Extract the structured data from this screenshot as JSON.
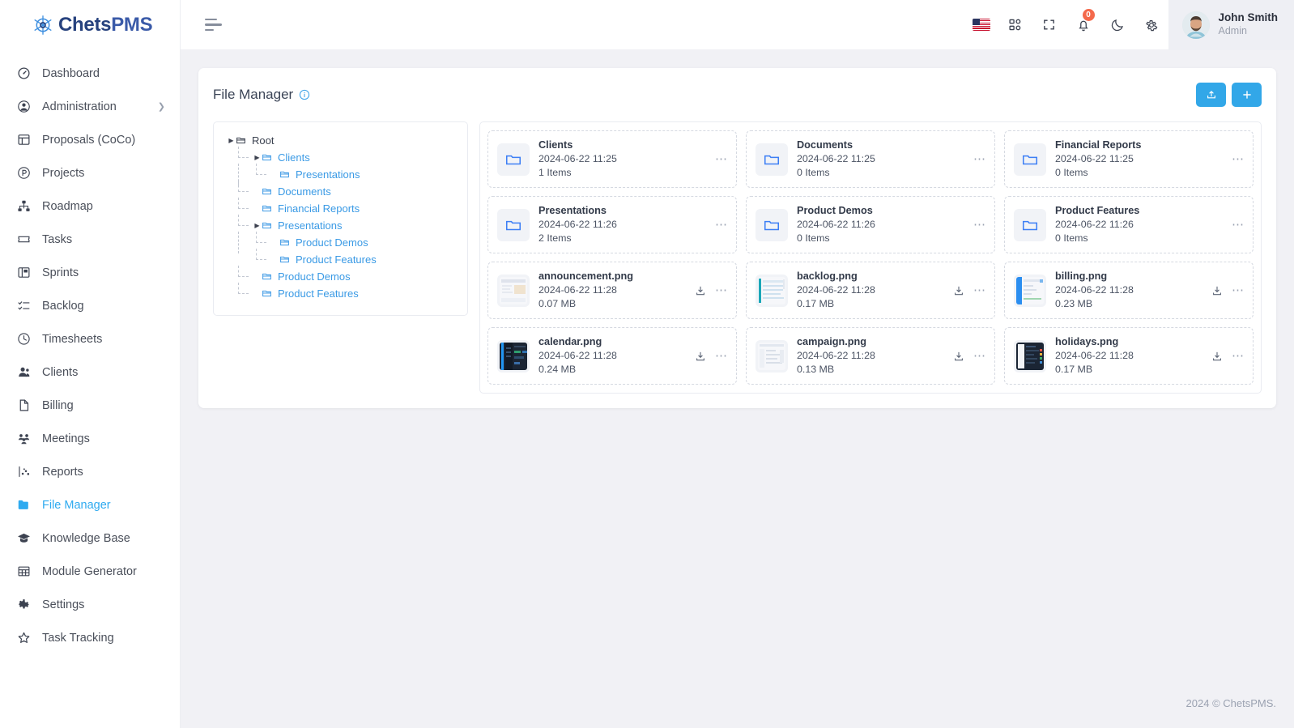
{
  "brand": {
    "name_part1": "Chets",
    "name_part2": "PMS",
    "logo_icon": "chets-logo-icon"
  },
  "sidebar": {
    "items": [
      {
        "label": "Dashboard",
        "icon": "speedometer-icon",
        "active": false,
        "expandable": false
      },
      {
        "label": "Administration",
        "icon": "user-circle-icon",
        "active": false,
        "expandable": true
      },
      {
        "label": "Proposals (CoCo)",
        "icon": "proposal-layout-icon",
        "active": false,
        "expandable": false
      },
      {
        "label": "Projects",
        "icon": "circle-p-icon",
        "active": false,
        "expandable": false
      },
      {
        "label": "Roadmap",
        "icon": "sitemap-icon",
        "active": false,
        "expandable": false
      },
      {
        "label": "Tasks",
        "icon": "ticket-icon",
        "active": false,
        "expandable": false
      },
      {
        "label": "Sprints",
        "icon": "board-icon",
        "active": false,
        "expandable": false
      },
      {
        "label": "Backlog",
        "icon": "checklist-icon",
        "active": false,
        "expandable": false
      },
      {
        "label": "Timesheets",
        "icon": "clock-icon",
        "active": false,
        "expandable": false
      },
      {
        "label": "Clients",
        "icon": "user-group-icon",
        "active": false,
        "expandable": false
      },
      {
        "label": "Billing",
        "icon": "document-icon",
        "active": false,
        "expandable": false
      },
      {
        "label": "Meetings",
        "icon": "people-icon",
        "active": false,
        "expandable": false
      },
      {
        "label": "Reports",
        "icon": "chart-scatter-icon",
        "active": false,
        "expandable": false
      },
      {
        "label": "File Manager",
        "icon": "folder-icon",
        "active": true,
        "expandable": false
      },
      {
        "label": "Knowledge Base",
        "icon": "graduation-cap-icon",
        "active": false,
        "expandable": false
      },
      {
        "label": "Module Generator",
        "icon": "grid-table-icon",
        "active": false,
        "expandable": false
      },
      {
        "label": "Settings",
        "icon": "gear-icon",
        "active": false,
        "expandable": false
      },
      {
        "label": "Task Tracking",
        "icon": "star-icon",
        "active": false,
        "expandable": false
      }
    ]
  },
  "topbar": {
    "menu_toggle_icon": "hamburger-icon",
    "icons": [
      {
        "name": "flag-us-icon"
      },
      {
        "name": "apps-grid-icon"
      },
      {
        "name": "fullscreen-icon"
      },
      {
        "name": "bell-icon",
        "badge": "0"
      },
      {
        "name": "moon-icon"
      },
      {
        "name": "gear-icon"
      }
    ],
    "notification_count": "0",
    "user": {
      "name": "John Smith",
      "role": "Admin",
      "avatar_icon": "user-avatar"
    }
  },
  "page": {
    "title": "File Manager",
    "info_icon": "info-circle-icon",
    "actions": [
      {
        "name": "upload-button",
        "icon": "upload-icon"
      },
      {
        "name": "add-button",
        "icon": "plus-icon"
      }
    ]
  },
  "tree": {
    "nodes": [
      {
        "label": "Root",
        "depth": 0,
        "caret": true,
        "root": true
      },
      {
        "label": "Clients",
        "depth": 1,
        "caret": true,
        "root": false
      },
      {
        "label": "Presentations",
        "depth": 2,
        "caret": false,
        "root": false
      },
      {
        "label": "Documents",
        "depth": 1,
        "caret": false,
        "root": false
      },
      {
        "label": "Financial Reports",
        "depth": 1,
        "caret": false,
        "root": false
      },
      {
        "label": "Presentations",
        "depth": 1,
        "caret": true,
        "root": false
      },
      {
        "label": "Product Demos",
        "depth": 2,
        "caret": false,
        "root": false
      },
      {
        "label": "Product Features",
        "depth": 2,
        "caret": false,
        "root": false
      },
      {
        "label": "Product Demos",
        "depth": 1,
        "caret": false,
        "root": false
      },
      {
        "label": "Product Features",
        "depth": 1,
        "caret": false,
        "root": false
      }
    ]
  },
  "files": {
    "column_hint": [
      "name",
      "modified",
      "size_or_items"
    ],
    "items": [
      {
        "name": "Clients",
        "modified": "2024-06-22 11:25",
        "sub": "1 Items",
        "type": "folder",
        "thumb": "folder-icon",
        "downloadable": false
      },
      {
        "name": "Documents",
        "modified": "2024-06-22 11:25",
        "sub": "0 Items",
        "type": "folder",
        "thumb": "folder-icon",
        "downloadable": false
      },
      {
        "name": "Financial Reports",
        "modified": "2024-06-22 11:25",
        "sub": "0 Items",
        "type": "folder",
        "thumb": "folder-icon",
        "downloadable": false
      },
      {
        "name": "Presentations",
        "modified": "2024-06-22 11:26",
        "sub": "2 Items",
        "type": "folder",
        "thumb": "folder-icon",
        "downloadable": false
      },
      {
        "name": "Product Demos",
        "modified": "2024-06-22 11:26",
        "sub": "0 Items",
        "type": "folder",
        "thumb": "folder-icon",
        "downloadable": false
      },
      {
        "name": "Product Features",
        "modified": "2024-06-22 11:26",
        "sub": "0 Items",
        "type": "folder",
        "thumb": "folder-icon",
        "downloadable": false
      },
      {
        "name": "announcement.png",
        "modified": "2024-06-22 11:28",
        "sub": "0.07 MB",
        "type": "image",
        "thumb": "image-thumb-light",
        "downloadable": true
      },
      {
        "name": "backlog.png",
        "modified": "2024-06-22 11:28",
        "sub": "0.17 MB",
        "type": "image",
        "thumb": "image-thumb-teal",
        "downloadable": true
      },
      {
        "name": "billing.png",
        "modified": "2024-06-22 11:28",
        "sub": "0.23 MB",
        "type": "image",
        "thumb": "image-thumb-blue",
        "downloadable": true
      },
      {
        "name": "calendar.png",
        "modified": "2024-06-22 11:28",
        "sub": "0.24 MB",
        "type": "image",
        "thumb": "image-thumb-dark",
        "downloadable": true
      },
      {
        "name": "campaign.png",
        "modified": "2024-06-22 11:28",
        "sub": "0.13 MB",
        "type": "image",
        "thumb": "image-thumb-pale",
        "downloadable": true
      },
      {
        "name": "holidays.png",
        "modified": "2024-06-22 11:28",
        "sub": "0.17 MB",
        "type": "image",
        "thumb": "image-thumb-dark2",
        "downloadable": true
      }
    ],
    "download_icon": "download-icon",
    "more_icon": "more-horizontal-icon"
  },
  "footer": {
    "text": "2024 © ChetsPMS."
  },
  "colors": {
    "accent": "#32a7e8",
    "active_nav": "#2eaaf0",
    "badge": "#f4694b",
    "folder_blue": "#3d7ff5",
    "page_bg": "#f1f1f5",
    "panel_bg": "#ffffff"
  }
}
